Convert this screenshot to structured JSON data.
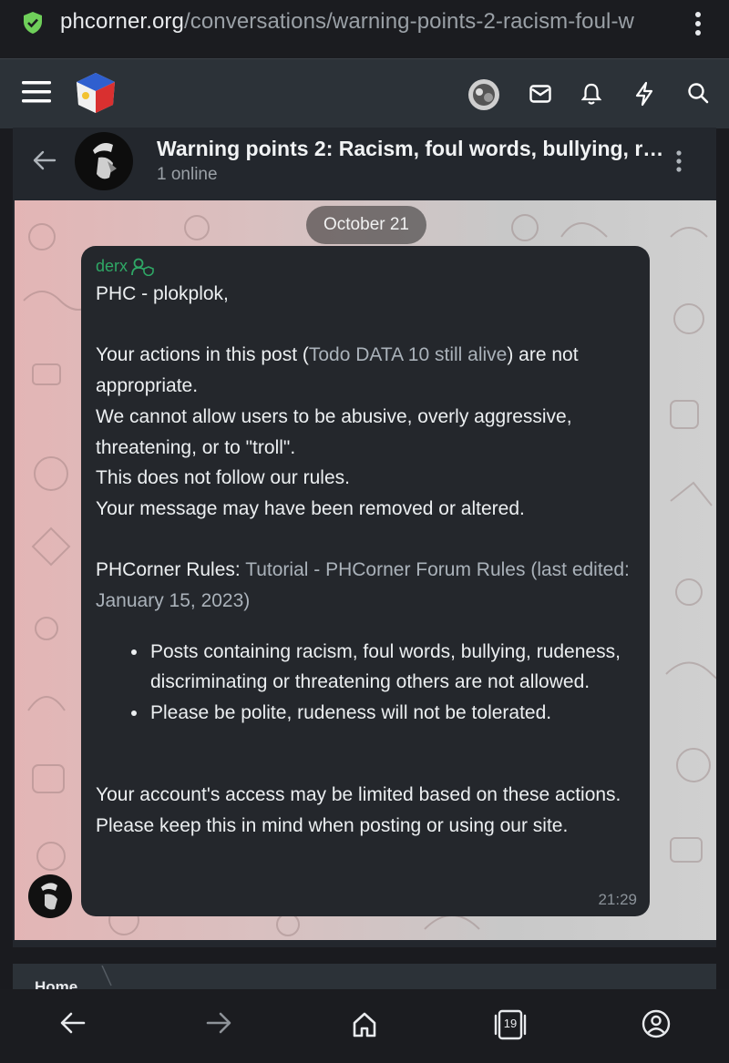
{
  "browser": {
    "url_host": "phcorner.org",
    "url_path": "/conversations/warning-points-2-racism-foul-w",
    "tab_count": "19"
  },
  "site_header": {
    "icons": [
      "menu-icon",
      "site-logo",
      "user-avatar",
      "inbox-icon",
      "bell-icon",
      "bolt-icon",
      "search-icon"
    ]
  },
  "conversation": {
    "title": "Warning points 2: Racism, foul words, bullying, ru...",
    "subtitle": "1 online"
  },
  "chat": {
    "date": "October 21",
    "sender": "derx",
    "greeting": "PHC - plokplok,",
    "line1_pre": "Your actions in this post (",
    "line1_link": "Todo DATA 10 still alive",
    "line1_post": ") are not appropriate.",
    "line2": "We cannot allow users to be abusive, overly aggressive, threatening, or to \"troll\".",
    "line3": "This does not follow our rules.",
    "line4": "Your message may have been removed or altered.",
    "rules_label": "PHCorner Rules: ",
    "rules_link": "Tutorial - PHCorner Forum Rules (last edited: January 15, 2023)",
    "bullets": [
      "Posts containing racism, foul words, bullying, rudeness, discriminating or threatening others are not allowed.",
      "Please be polite, rudeness will not be tolerated."
    ],
    "closing": "Your account's access may be limited based on these actions. Please keep this in mind when posting or using our site.",
    "time": "21:29"
  },
  "breadcrumb": {
    "home": "Home"
  },
  "colors": {
    "accent_green": "#2fa866",
    "bubble": "#24272c",
    "header": "#2c3238"
  }
}
